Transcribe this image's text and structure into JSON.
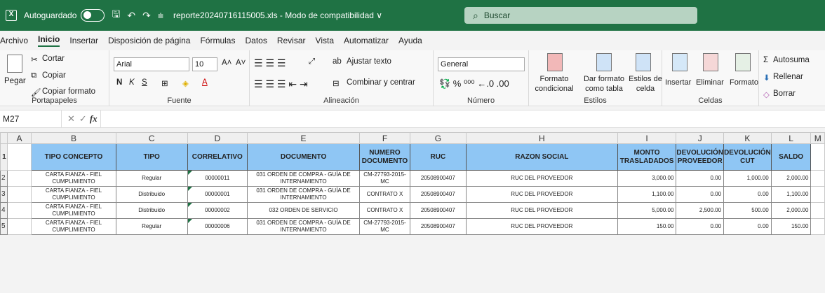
{
  "titlebar": {
    "app_icon": "X",
    "autosave_label": "Autoguardado",
    "filename": "reporte20240716115005.xls - Modo de compatibilidad ∨",
    "search_placeholder": "Buscar"
  },
  "menu": [
    "Archivo",
    "Inicio",
    "Insertar",
    "Disposición de página",
    "Fórmulas",
    "Datos",
    "Revisar",
    "Vista",
    "Automatizar",
    "Ayuda"
  ],
  "ribbon": {
    "clipboard": {
      "paste": "Pegar",
      "cut": "Cortar",
      "copy": "Copiar",
      "copy_format": "Copiar formato",
      "label": "Portapapeles"
    },
    "font": {
      "name": "Arial",
      "size": "10",
      "bold": "N",
      "italic": "K",
      "underline": "S",
      "label": "Fuente"
    },
    "alignment": {
      "wrap": "Ajustar texto",
      "merge": "Combinar y centrar",
      "label": "Alineación"
    },
    "number": {
      "format": "General",
      "label": "Número"
    },
    "styles": {
      "conditional": "Formato condicional",
      "as_table": "Dar formato como tabla",
      "cell_styles": "Estilos de celda",
      "label": "Estilos"
    },
    "cells": {
      "insert": "Insertar",
      "delete": "Eliminar",
      "format": "Formato",
      "label": "Celdas"
    },
    "editing": {
      "autosum": "Autosuma",
      "fill": "Rellenar",
      "clear": "Borrar"
    }
  },
  "formula_bar": {
    "cell_ref": "M27",
    "fx": "fx",
    "content": ""
  },
  "columns": [
    "A",
    "B",
    "C",
    "D",
    "E",
    "F",
    "G",
    "H",
    "I",
    "J",
    "K",
    "L",
    "M"
  ],
  "headers": [
    "TIPO CONCEPTO",
    "TIPO",
    "CORRELATIVO",
    "DOCUMENTO",
    "NUMERO DOCUMENTO",
    "RUC",
    "RAZON SOCIAL",
    "MONTO TRASLADADOS",
    "DEVOLUCIÓN PROVEEDOR",
    "DEVOLUCIÓN CUT",
    "SALDO"
  ],
  "rows": [
    {
      "n": "2",
      "tipo_concepto": "CARTA FIANZA - FIEL CUMPLIMIENTO",
      "tipo": "Regular",
      "correlativo": "00000011",
      "documento": "031 ORDEN DE COMPRA - GUÍA DE INTERNAMIENTO",
      "numero": "CM-27793-2015-MC",
      "ruc": "20508900407",
      "razon": "RUC DEL PROVEEDOR",
      "monto": "3,000.00",
      "dev_prov": "0.00",
      "dev_cut": "1,000.00",
      "saldo": "2,000.00"
    },
    {
      "n": "3",
      "tipo_concepto": "CARTA FIANZA - FIEL CUMPLIMIENTO",
      "tipo": "Distribuido",
      "correlativo": "00000001",
      "documento": "031 ORDEN DE COMPRA - GUÍA DE INTERNAMIENTO",
      "numero": "CONTRATO X",
      "ruc": "20508900407",
      "razon": "RUC DEL PROVEEDOR",
      "monto": "1,100.00",
      "dev_prov": "0.00",
      "dev_cut": "0.00",
      "saldo": "1,100.00"
    },
    {
      "n": "4",
      "tipo_concepto": "CARTA FIANZA - FIEL CUMPLIMIENTO",
      "tipo": "Distribuido",
      "correlativo": "00000002",
      "documento": "032 ORDEN DE SERVICIO",
      "numero": "CONTRATO X",
      "ruc": "20508900407",
      "razon": "RUC DEL PROVEEDOR",
      "monto": "5,000.00",
      "dev_prov": "2,500.00",
      "dev_cut": "500.00",
      "saldo": "2,000.00"
    },
    {
      "n": "5",
      "tipo_concepto": "CARTA FIANZA - FIEL CUMPLIMIENTO",
      "tipo": "Regular",
      "correlativo": "00000006",
      "documento": "031 ORDEN DE COMPRA - GUÍA DE INTERNAMIENTO",
      "numero": "CM-27793-2015-MC",
      "ruc": "20508900407",
      "razon": "RUC DEL PROVEEDOR",
      "monto": "150.00",
      "dev_prov": "0.00",
      "dev_cut": "0.00",
      "saldo": "150.00"
    }
  ]
}
